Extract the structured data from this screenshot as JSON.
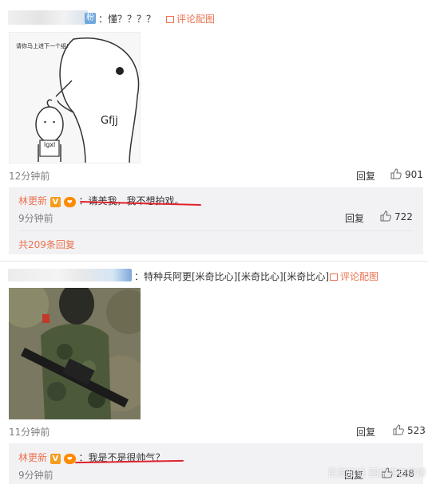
{
  "comment1": {
    "name_tag": "粉",
    "text": "：懂？？？？",
    "pic_comment_label": "评论配图",
    "image_caption": "请你马上进下一个组!",
    "image_label_big": "Gfjj",
    "image_label_small": "lgxl",
    "time": "12分钟前",
    "reply_label": "回复",
    "likes": "901",
    "reply": {
      "author": "林更新",
      "v_badge": "V",
      "text": "：请美我，我不想拍戏。",
      "time": "9分钟前",
      "reply_label": "回复",
      "likes": "722"
    },
    "more_replies": "共209条回复"
  },
  "comment2": {
    "text": "：特种兵阿更[米奇比心][米奇比心][米奇比心]",
    "pic_comment_label": "评论配图",
    "time": "11分钟前",
    "reply_label": "回复",
    "likes": "523",
    "reply": {
      "author": "林更新",
      "v_badge": "V",
      "text": "：我是不是很帅气？",
      "time": "9分钟前",
      "reply_label": "回复",
      "likes": "248"
    }
  },
  "watermark": "百度知道 图片来自微博",
  "colors": {
    "link": "#eb7350",
    "underline": "#e0232c",
    "reply_bg": "#f2f2f5"
  }
}
